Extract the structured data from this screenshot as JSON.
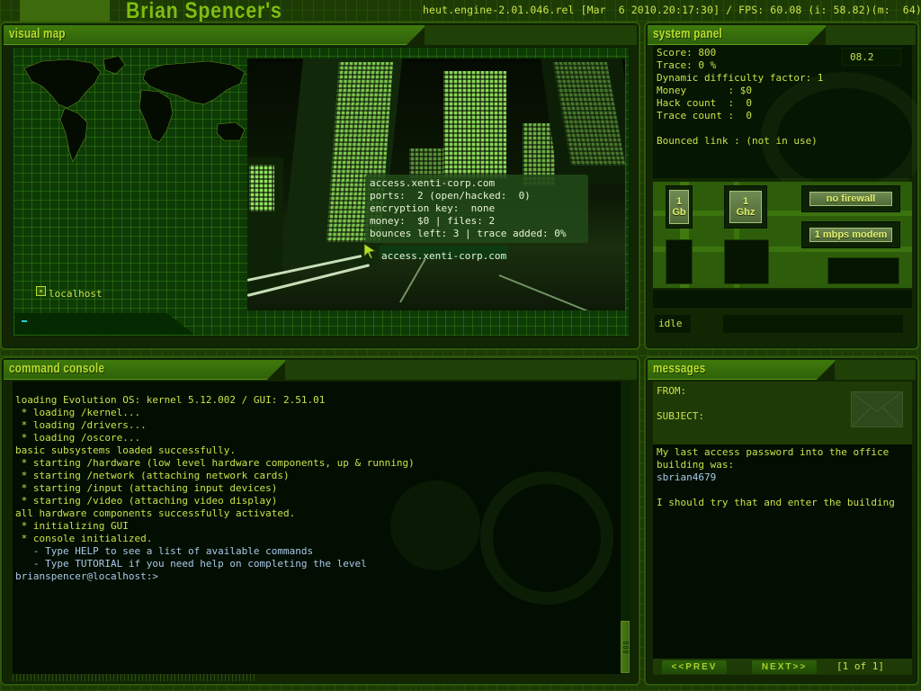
{
  "header": {
    "brand_title": "Brian Spencer's",
    "engine_status": "heut.engine-2.01.046.rel [Mar  6 2010.20:17:30] / FPS: 60.08 (i: 58.82)(m:  64)"
  },
  "visual_map": {
    "title": "visual map",
    "nodes": [
      {
        "label": "localhost",
        "icon": "node-square-icon"
      }
    ],
    "target_host": {
      "name": "access.xenti-corp.com",
      "details": [
        "access.xenti-corp.com",
        "ports:  2 (open/hacked:  0)",
        "encryption key:  none",
        "money:  $0 | files: 2",
        "bounces left: 3 | trace added: 0%"
      ],
      "label": "access.xenti-corp.com"
    },
    "cursor_text": "_"
  },
  "system_panel": {
    "title": "system panel",
    "version": "08.2",
    "stats": [
      "Score: 800",
      "Trace: 0 %",
      "Dynamic difficulty factor: 1",
      "Money       : $0",
      "Hack count  :  0",
      "Trace count :  0",
      "",
      "Bounced link : (not in use)"
    ],
    "hardware": {
      "memory_top": "1",
      "memory_bottom": "Gb",
      "cpu_top": "1",
      "cpu_bottom": "Ghz",
      "firewall": "no firewall",
      "modem": "1 mbps modem"
    },
    "status": "idle"
  },
  "command_console": {
    "title": "command console",
    "lines": [
      {
        "text": "loading Evolution OS: kernel 5.12.002 / GUI: 2.51.01",
        "type": "normal"
      },
      {
        "text": " * loading /kernel...",
        "type": "normal"
      },
      {
        "text": " * loading /drivers...",
        "type": "normal"
      },
      {
        "text": " * loading /oscore...",
        "type": "normal"
      },
      {
        "text": "basic subsystems loaded successfully.",
        "type": "normal"
      },
      {
        "text": " * starting /hardware (low level hardware components, up & running)",
        "type": "normal"
      },
      {
        "text": " * starting /network (attaching network cards)",
        "type": "normal"
      },
      {
        "text": " * starting /input (attaching input devices)",
        "type": "normal"
      },
      {
        "text": " * starting /video (attaching video display)",
        "type": "normal"
      },
      {
        "text": "all hardware components successfully activated.",
        "type": "normal"
      },
      {
        "text": " * initializing GUI",
        "type": "normal"
      },
      {
        "text": " * console initialized.",
        "type": "normal"
      },
      {
        "text": "   - Type HELP to see a list of available commands",
        "type": "info"
      },
      {
        "text": "   - Type TUTORIAL if you need help on completing the level",
        "type": "info"
      },
      {
        "text": "brianspencer@localhost:>",
        "type": "info"
      }
    ]
  },
  "messages": {
    "title": "messages",
    "from_label": "FROM:",
    "subject_label": "SUBJECT:",
    "body": [
      {
        "text": "My last access password into the office",
        "type": "normal"
      },
      {
        "text": "building was:",
        "type": "normal"
      },
      {
        "text": "sbrian4679",
        "type": "pw"
      },
      {
        "text": "",
        "type": "normal"
      },
      {
        "text": "I should try that and enter the building",
        "type": "normal"
      }
    ],
    "prev_label": "<<PREV",
    "next_label": "NEXT>>",
    "page_indicator": "[1 of 1]"
  }
}
